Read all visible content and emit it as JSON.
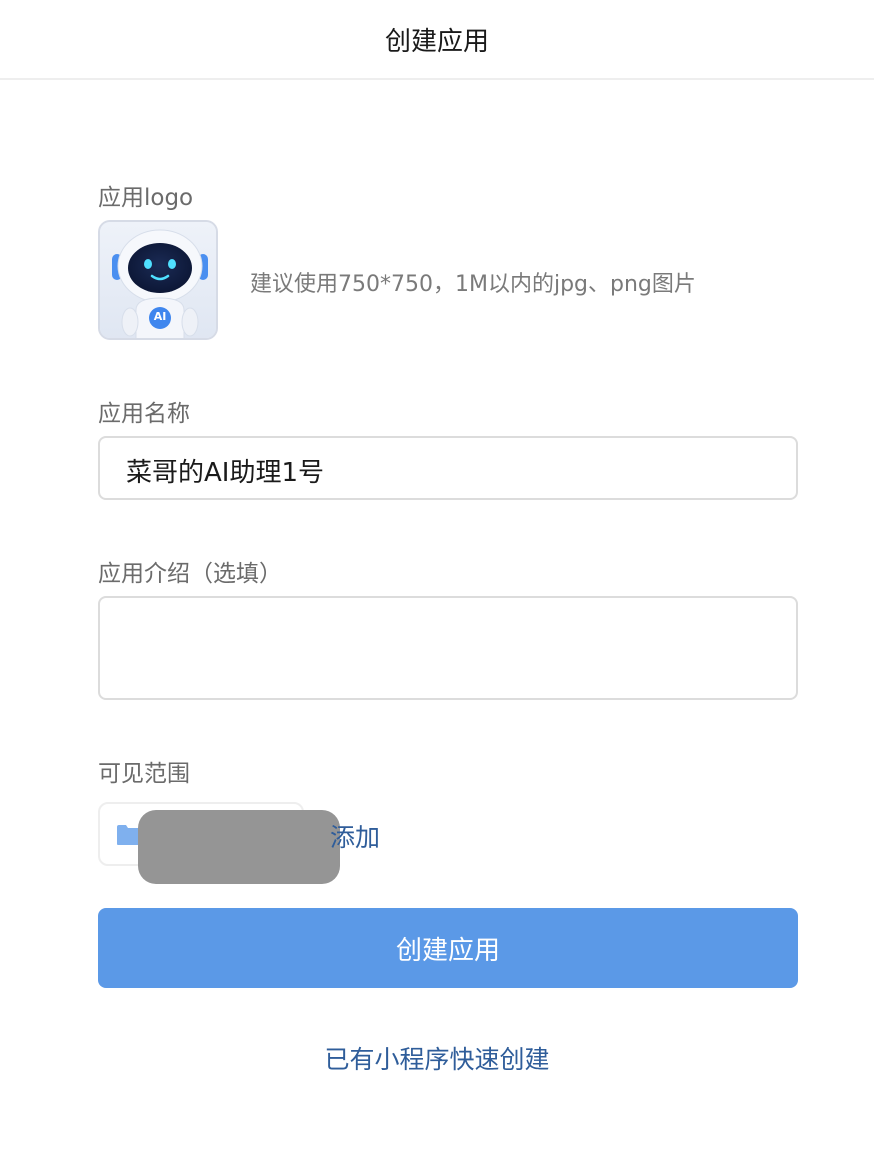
{
  "header": {
    "title": "创建应用"
  },
  "logo": {
    "label": "应用logo",
    "hint": "建议使用750*750，1M以内的jpg、png图片",
    "badge_text": "AI"
  },
  "name": {
    "label": "应用名称",
    "value": "菜哥的AI助理1号"
  },
  "description": {
    "label": "应用介绍（选填）",
    "value": ""
  },
  "scope": {
    "label": "可见范围",
    "add_label": "添加"
  },
  "actions": {
    "create_label": "创建应用",
    "quick_create_label": "已有小程序快速创建"
  },
  "colors": {
    "primary": "#5b99e7",
    "link": "#2f5d9a",
    "folder": "#7fb0ee"
  }
}
